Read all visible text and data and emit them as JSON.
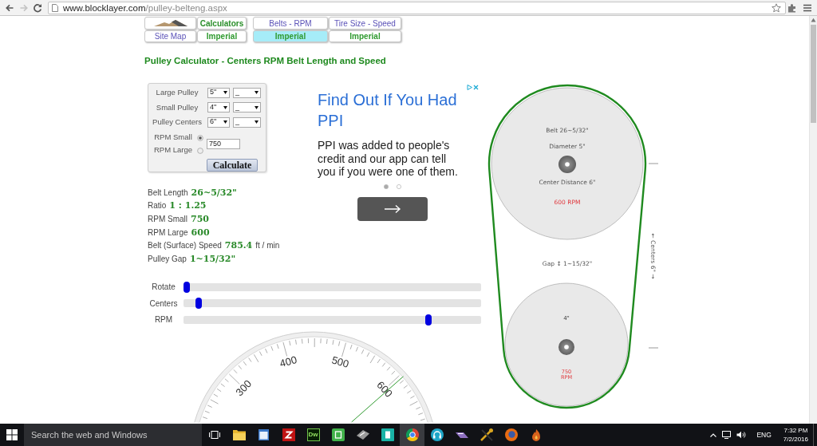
{
  "browser": {
    "nav_buttons": [
      {
        "kind": "back",
        "disabled": false
      },
      {
        "kind": "forward",
        "disabled": true
      },
      {
        "kind": "reload",
        "disabled": false
      }
    ],
    "url": {
      "host": "www.blocklayer.com",
      "path": "/pulley-belteng.aspx"
    }
  },
  "nav": {
    "rows": [
      [
        {
          "kind": "logo",
          "selected": false
        },
        {
          "kind": "section",
          "label": "Calculators",
          "selected": false
        },
        {
          "kind": "link",
          "label": "Belts - RPM",
          "selected": false
        },
        {
          "kind": "link",
          "label": "Tire Size - Speed",
          "selected": false
        }
      ],
      [
        {
          "kind": "link",
          "label": "Site Map",
          "selected": false
        },
        {
          "kind": "unit",
          "label": "Imperial",
          "selected": false
        },
        {
          "kind": "unit",
          "label": "Imperial",
          "selected": true
        },
        {
          "kind": "unit",
          "label": "Imperial",
          "selected": false
        }
      ]
    ]
  },
  "title": "Pulley Calculator - Centers RPM Belt Length and Speed",
  "form": {
    "rows": [
      {
        "label": "Large Pulley",
        "inches": "5\"",
        "fraction": "_"
      },
      {
        "label": "Small Pulley",
        "inches": "4\"",
        "fraction": "_"
      },
      {
        "label": "Pulley Centers",
        "inches": "6\"",
        "fraction": "_"
      }
    ],
    "rpm_options": [
      {
        "label": "RPM Small",
        "selected": true
      },
      {
        "label": "RPM Large",
        "selected": false
      }
    ],
    "rpm_input": {
      "value": "750"
    },
    "button": "Calculate"
  },
  "results": [
    {
      "label": "Belt Length",
      "value": "26~5/32\""
    },
    {
      "label": "Ratio",
      "value": "1 : 1.25"
    },
    {
      "label": "RPM Small",
      "value": "750"
    },
    {
      "label": "RPM Large",
      "value": "600"
    },
    {
      "label": "Belt (Surface) Speed",
      "value": "785.4",
      "unit": "ft / min"
    },
    {
      "label": "Pulley Gap",
      "value": "1~15/32\""
    }
  ],
  "ad": {
    "headline": "Find Out If You Had PPI",
    "body": "PPI was added to people's credit and our app can tell you if you were one of them.",
    "dots": [
      {
        "selected": true
      },
      {
        "selected": false
      }
    ]
  },
  "sliders": [
    {
      "label": "Rotate",
      "level": 0
    },
    {
      "label": "Centers",
      "level": 0.04
    },
    {
      "label": "RPM",
      "level": 0.83
    }
  ],
  "gauge": {
    "labels": [
      "300",
      "400",
      "500",
      "600"
    ],
    "level": 0.77
  },
  "diagram": {
    "belt": "Belt 26~5/32\"",
    "large_diameter": "Diameter 5\"",
    "center_distance": "Center Distance 6\"",
    "large_rpm": "600 RPM",
    "gap": "Gap ↕ 1~15/32\"",
    "small_diameter": "4\"",
    "small_rpm": [
      "750",
      "RPM"
    ],
    "centers": "← Centers 6\" →"
  },
  "taskbar": {
    "search": {
      "placeholder": "Search the web and Windows"
    },
    "apps": [
      {
        "kind": "taskview",
        "selected": false
      },
      {
        "kind": "folder",
        "selected": false
      },
      {
        "kind": "window",
        "selected": false
      },
      {
        "kind": "zigzag",
        "selected": false
      },
      {
        "kind": "lettertile",
        "label": "Dw",
        "selected": false
      },
      {
        "kind": "sheet",
        "selected": false
      },
      {
        "kind": "gadget",
        "selected": false
      },
      {
        "kind": "document",
        "selected": false
      },
      {
        "kind": "wheel",
        "selected": true
      },
      {
        "kind": "headphones",
        "selected": false
      },
      {
        "kind": "plug",
        "selected": false
      },
      {
        "kind": "tools",
        "selected": false
      },
      {
        "kind": "globe",
        "selected": false
      },
      {
        "kind": "flame",
        "selected": false
      }
    ],
    "tray": {
      "language": "ENG",
      "time": "7:32 PM",
      "date": "7/2/2016"
    }
  }
}
